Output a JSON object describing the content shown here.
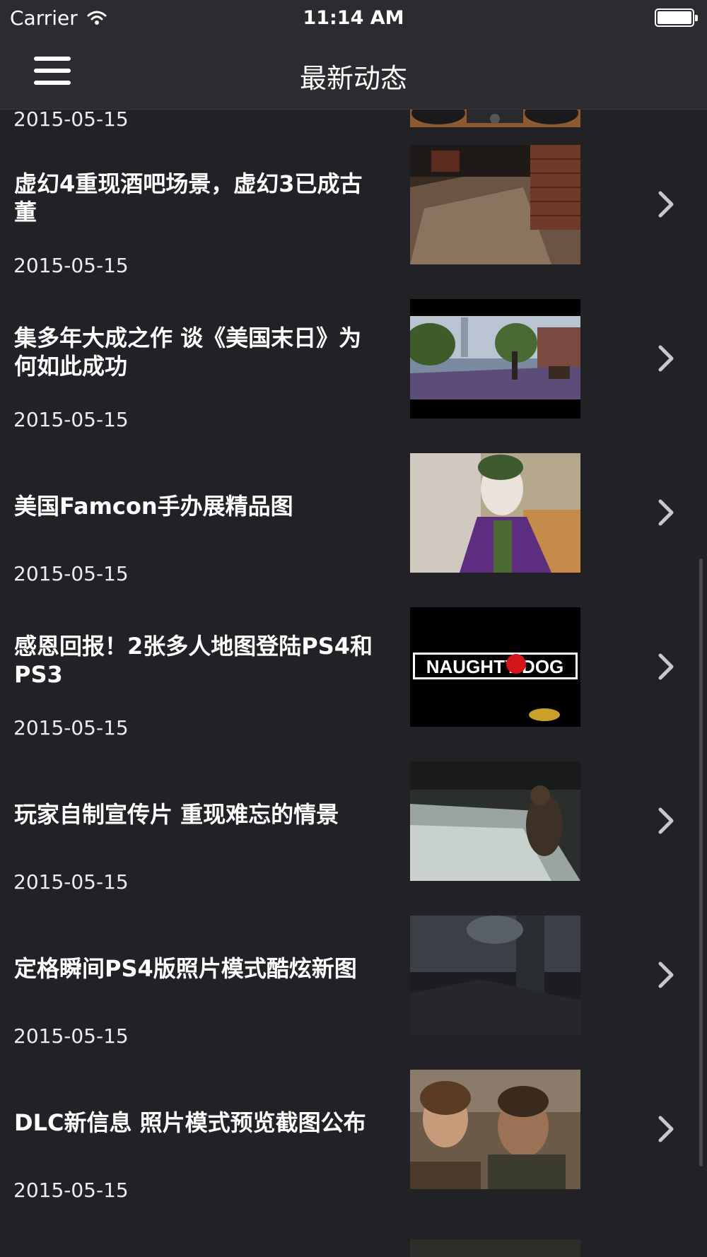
{
  "status_bar": {
    "carrier": "Carrier",
    "time": "11:14 AM"
  },
  "nav": {
    "title": "最新动态",
    "menu_icon": "hamburger-menu-icon"
  },
  "list": {
    "top_partial_date": "2015-05-15",
    "items": [
      {
        "title": "虚幻4重现酒吧场景，虚幻3已成古董",
        "date": "2015-05-15",
        "image": "bar-scene-thumbnail"
      },
      {
        "title": "集多年大成之作 谈《美国末日》为何如此成功",
        "date": "2015-05-15",
        "image": "city-ruins-thumbnail"
      },
      {
        "title": "美国Famcon手办展精品图",
        "date": "2015-05-15",
        "image": "joker-figure-thumbnail"
      },
      {
        "title": "感恩回报！2张多人地图登陆PS4和PS3",
        "date": "2015-05-15",
        "image": "naughty-dog-logo-thumbnail",
        "logo_text": "NAUGHTY DOG"
      },
      {
        "title": "玩家自制宣传片 重现难忘的情景",
        "date": "2015-05-15",
        "image": "waterfall-scene-thumbnail"
      },
      {
        "title": "定格瞬间PS4版照片模式酷炫新图",
        "date": "2015-05-15",
        "image": "dark-ruins-thumbnail"
      },
      {
        "title": "DLC新信息 照片模式预览截图公布",
        "date": "2015-05-15",
        "image": "characters-thumbnail"
      }
    ]
  },
  "icons": {
    "row_chevron": "chevron-right-icon",
    "wifi": "wifi-icon",
    "battery": "battery-icon"
  }
}
